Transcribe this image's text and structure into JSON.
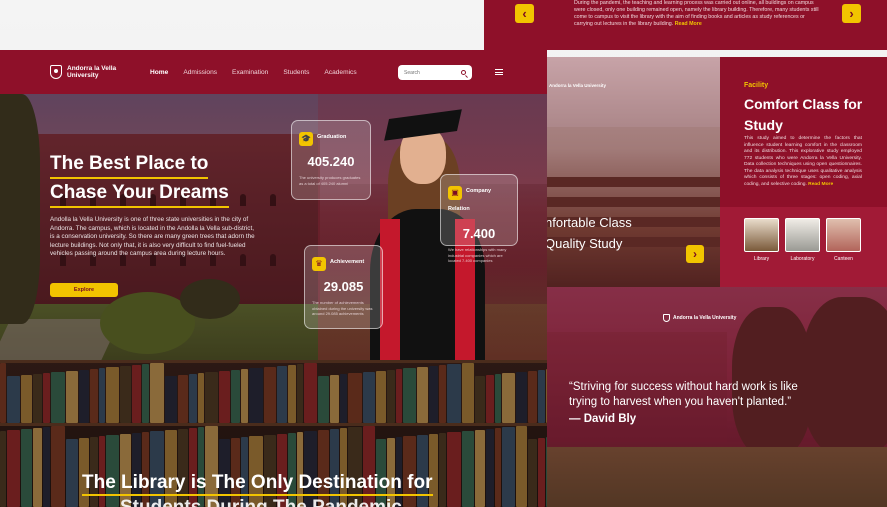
{
  "top_strip": {
    "text": "During the pandemi, the teaching and learning process was carried out online, all buildings on campus were closed, only one building remained open, namely the library building. Therefore, many students still come to campus to visit the library with the aim of finding books and articles as study references or carrying out lectures in the library building.",
    "read_more": "Read More",
    "arrow_left": "‹",
    "arrow_right": "›"
  },
  "brand": {
    "name": "Andorra la Vella University"
  },
  "nav": {
    "items": [
      "Home",
      "Admissions",
      "Examination",
      "Students",
      "Academics"
    ],
    "search_placeholder": "Search"
  },
  "hero": {
    "title_line1": "The Best Place to",
    "title_line2": "Chase Your Dreams",
    "description": "Andolla la Vella University is one of three state universities in the city of Andorra. The campus, which is located in the Andolla la Vella sub-district, is a conservation university. So there are many green trees that adorn the lecture buildings. Not only that, it is also very difficult to find fuel-fueled vehicles passing around the campus area during lecture hours.",
    "explore_label": "Explore"
  },
  "stats": [
    {
      "label": "Graduation",
      "value": "405.240",
      "text": "The university produces graduates as a total of 405.240 alumni"
    },
    {
      "label": "Company Relation",
      "value": "7.400",
      "text": "We have relationships with many industrial companies which are located 7.400 companies"
    },
    {
      "label": "Achievement",
      "value": "29.085",
      "text": "The number of achievements obtained during the university was around 29.085 achievements"
    }
  ],
  "library": {
    "title": "The Library is The Only Destination for",
    "title_line2": "Students During The Pandemic"
  },
  "facility_image": {
    "caption_line1": "nfortable Class",
    "caption_line2": "Quality Study",
    "logo": "Andorra la Vella University",
    "arrow": "›"
  },
  "facility": {
    "tag": "Facility",
    "title": "Comfort Class for Study",
    "description": "This study aimed to determine the factors that influence student learning comfort in the classroom and its distribution. This explorative study employed 772 students who were Andorra la Vella University. Data collection techniques using open questionnaires. The data analysis technique uses qualitative analysis which consists of three stages: open coding, axial coding, and selective coding.",
    "read_more": "Read More",
    "thumbs": [
      "Library",
      "Laboratory",
      "Canteen"
    ]
  },
  "quote": {
    "logo": "Andorra la Vella University",
    "text": "“Striving for success without hard work is like trying to harvest when you haven't planted.”",
    "author": "— David Bly"
  },
  "colors": {
    "brand": "#8e1029",
    "accent": "#f2c400"
  }
}
